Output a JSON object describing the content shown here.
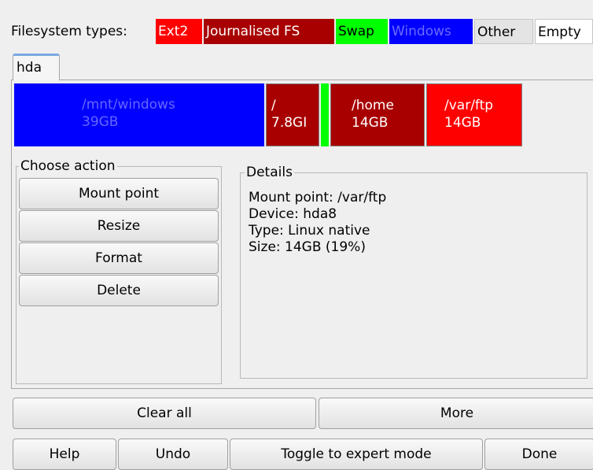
{
  "legend": {
    "label": "Filesystem types:",
    "types": {
      "ext2": "Ext2",
      "journalised": "Journalised FS",
      "swap": "Swap",
      "windows": "Windows",
      "other": "Other",
      "empty": "Empty"
    },
    "colors": {
      "ext2": "#ff0000",
      "journalised": "#a80000",
      "swap": "#00ff00",
      "windows": "#0000ff",
      "other": "#e4e4e4",
      "empty": "#ffffff"
    }
  },
  "tabs": [
    {
      "label": "hda"
    }
  ],
  "partitions": {
    "windows": {
      "mount": "/mnt/windows",
      "size": "39GB"
    },
    "root": {
      "mount": "/",
      "size": "7.8GI"
    },
    "swap": {
      "mount": "",
      "size": ""
    },
    "home": {
      "mount": "/home",
      "size": "14GB"
    },
    "ftp": {
      "mount": "/var/ftp",
      "size": "14GB"
    }
  },
  "actions": {
    "title": "Choose action",
    "mount_point": "Mount point",
    "resize": "Resize",
    "format": "Format",
    "delete": "Delete"
  },
  "details": {
    "title": "Details",
    "mount_point": "Mount point: /var/ftp",
    "device": "Device: hda8",
    "type": "Type: Linux native",
    "size": "Size: 14GB (19%)"
  },
  "buttons": {
    "clear_all": "Clear all",
    "more": "More",
    "help": "Help",
    "undo": "Undo",
    "toggle_expert": "Toggle to expert mode",
    "done": "Done"
  }
}
